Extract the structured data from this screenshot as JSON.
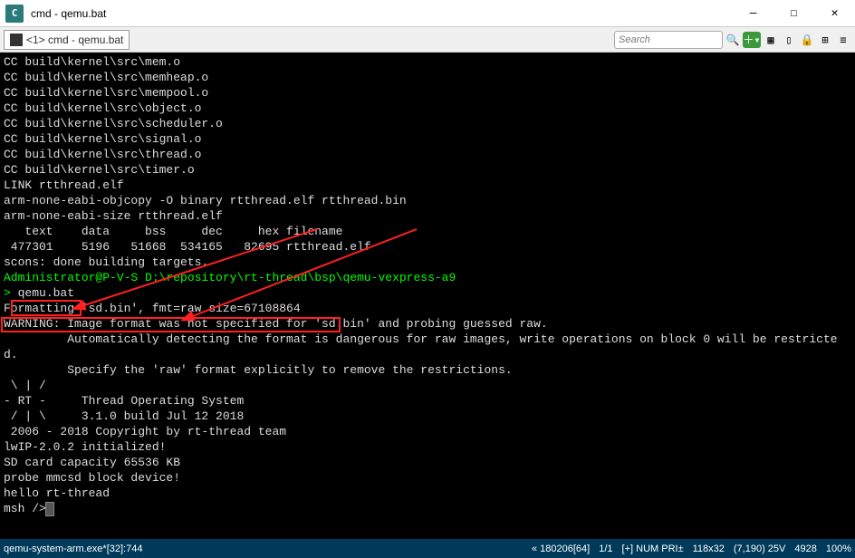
{
  "window": {
    "title": "cmd - qemu.bat",
    "app_icon_text": "C"
  },
  "tab": {
    "label": "<1> cmd - qemu.bat"
  },
  "search": {
    "placeholder": "Search"
  },
  "terminal": {
    "lines": [
      "CC build\\kernel\\src\\mem.o",
      "CC build\\kernel\\src\\memheap.o",
      "CC build\\kernel\\src\\mempool.o",
      "CC build\\kernel\\src\\object.o",
      "CC build\\kernel\\src\\scheduler.o",
      "CC build\\kernel\\src\\signal.o",
      "CC build\\kernel\\src\\thread.o",
      "CC build\\kernel\\src\\timer.o",
      "LINK rtthread.elf",
      "arm-none-eabi-objcopy -O binary rtthread.elf rtthread.bin",
      "arm-none-eabi-size rtthread.elf",
      "   text    data     bss     dec     hex filename",
      " 477301    5196   51668  534165   82695 rtthread.elf",
      "scons: done building targets.",
      ""
    ],
    "prompt_line": "Administrator@P-V-S D:\\repository\\rt-thread\\bsp\\qemu-vexpress-a9",
    "cmd_prompt": "> ",
    "cmd_text": "qemu.bat",
    "after_cmd": [
      "Formatting 'sd.bin', fmt=raw size=67108864",
      "WARNING: Image format was not specified for 'sd.bin' and probing guessed raw.",
      "         Automatically detecting the format is dangerous for raw images, write operations on block 0 will be restricte",
      "d.",
      "         Specify the 'raw' format explicitly to remove the restrictions.",
      "",
      " \\ | /",
      "- RT -     Thread Operating System",
      " / | \\     3.1.0 build Jul 12 2018",
      " 2006 - 2018 Copyright by rt-thread team",
      "lwIP-2.0.2 initialized!",
      "SD card capacity 65536 KB",
      "probe mmcsd block device!",
      "hello rt-thread"
    ],
    "msh_prompt": "msh />"
  },
  "status": {
    "left": "qemu-system-arm.exe*[32]:744",
    "items": [
      "« 180206[64]",
      "1/1",
      "[+] NUM  PRI±",
      "118x32",
      "(7,190) 25V",
      "4928",
      "100%"
    ]
  }
}
